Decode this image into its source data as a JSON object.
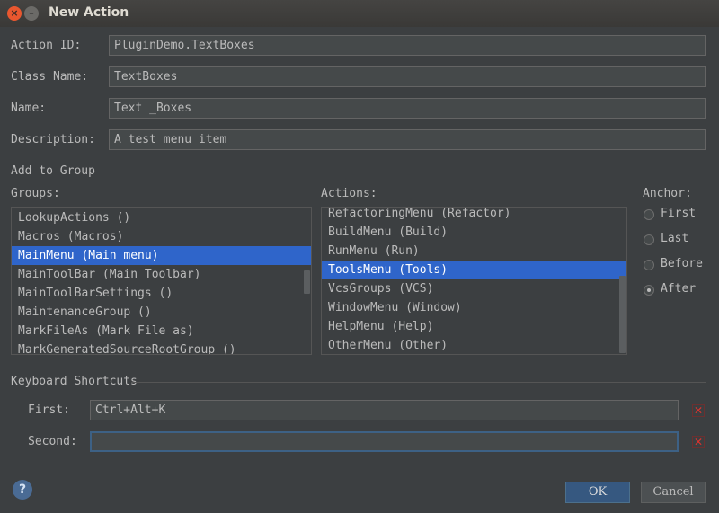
{
  "window": {
    "title": "New Action",
    "close_glyph": "×",
    "min_glyph": "–"
  },
  "form": {
    "action_id": {
      "label": "Action ID:",
      "value": "PluginDemo.TextBoxes"
    },
    "class_name": {
      "label": "Class Name:",
      "value": "TextBoxes"
    },
    "name": {
      "label": "Name:",
      "value": "Text _Boxes"
    },
    "description": {
      "label": "Description:",
      "value": "A test menu item"
    }
  },
  "add_to_group": {
    "section_label": "Add to Group",
    "groups_label": "Groups:",
    "groups": [
      "LookupActions ()",
      "Macros (Macros)",
      "MainMenu (Main menu)",
      "MainToolBar (Main Toolbar)",
      "MainToolBarSettings ()",
      "MaintenanceGroup ()",
      "MarkFileAs (Mark File as)",
      "MarkGeneratedSourceRootGroup ()"
    ],
    "groups_selected_index": 2,
    "actions_label": "Actions:",
    "actions": [
      "RefactoringMenu (Refactor)",
      "BuildMenu (Build)",
      "RunMenu (Run)",
      "ToolsMenu (Tools)",
      "VcsGroups (VCS)",
      "WindowMenu (Window)",
      "HelpMenu (Help)",
      "OtherMenu (Other)"
    ],
    "actions_selected_index": 3,
    "anchor_label": "Anchor:",
    "anchors": [
      "First",
      "Last",
      "Before",
      "After"
    ],
    "anchor_selected": "After"
  },
  "shortcuts": {
    "section_label": "Keyboard Shortcuts",
    "first_label": "First:",
    "first_value": "Ctrl+Alt+K",
    "second_label": "Second:",
    "second_value": "",
    "clear_glyph": "✕"
  },
  "buttons": {
    "help": "?",
    "ok": "OK",
    "cancel": "Cancel"
  },
  "colors": {
    "background": "#3c3f41",
    "selection": "#2f65ca",
    "focus": "#3d6185",
    "clear_icon": "#d8342f"
  }
}
